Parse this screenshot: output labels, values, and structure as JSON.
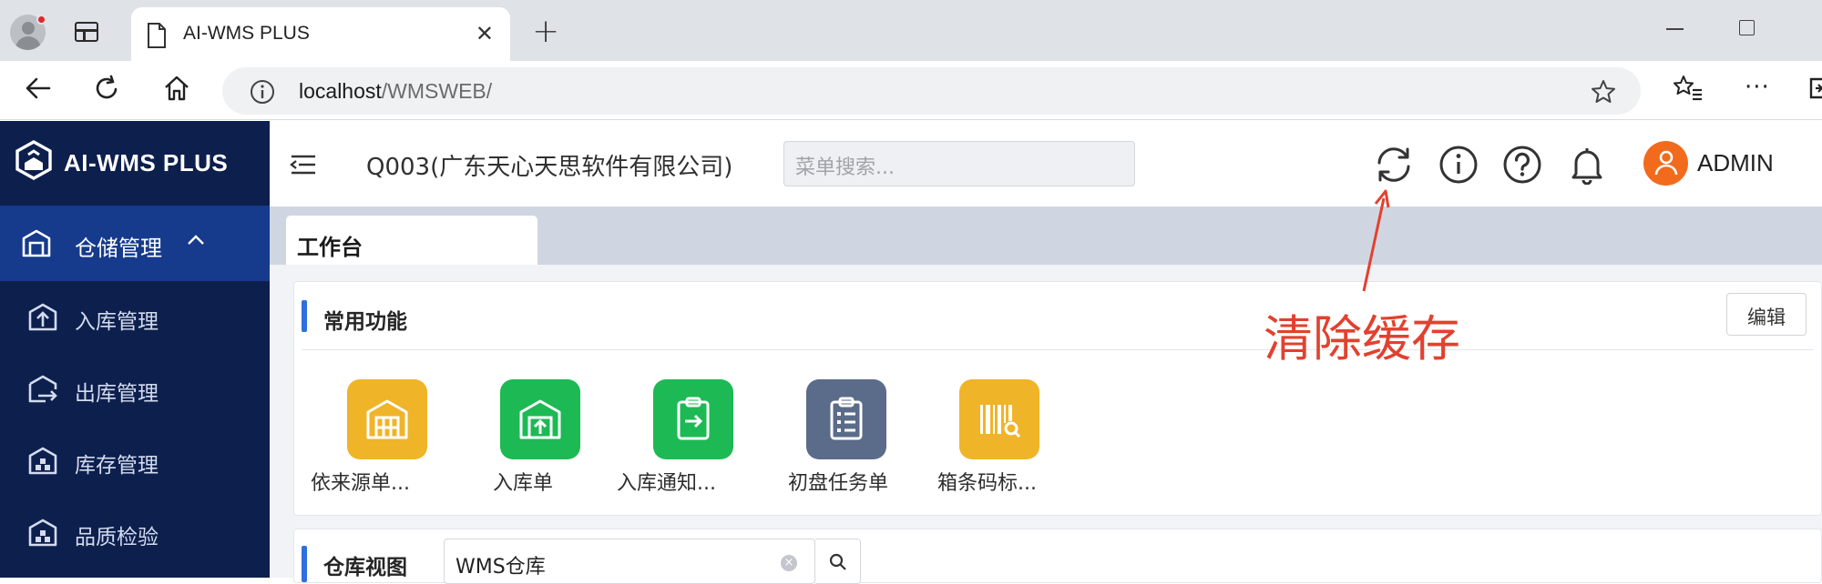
{
  "browser": {
    "tab_title": "AI-WMS PLUS",
    "url_host": "localhost",
    "url_path": "/WMSWEB/"
  },
  "app": {
    "logo_text": "AI-WMS PLUS",
    "company": "Q003(广东天心天思软件有限公司)",
    "search_placeholder": "菜单搜索...",
    "user": "ADMIN"
  },
  "sidebar": {
    "group": "仓储管理",
    "items": [
      {
        "label": "入库管理",
        "icon": "inbound-icon"
      },
      {
        "label": "出库管理",
        "icon": "outbound-icon"
      },
      {
        "label": "库存管理",
        "icon": "inventory-icon"
      },
      {
        "label": "品质检验",
        "icon": "quality-icon"
      }
    ]
  },
  "tabs": {
    "active": "工作台"
  },
  "common_functions": {
    "title": "常用功能",
    "edit_label": "编辑",
    "items": [
      {
        "label": "依来源单...",
        "color": "#f0b429",
        "icon": "warehouse-grid-icon"
      },
      {
        "label": "入库单",
        "color": "#1db954",
        "icon": "warehouse-in-icon"
      },
      {
        "label": "入库通知...",
        "color": "#1db954",
        "icon": "clipboard-arrow-icon"
      },
      {
        "label": "初盘任务单",
        "color": "#5b6b8a",
        "icon": "checklist-icon"
      },
      {
        "label": "箱条码标...",
        "color": "#f0b429",
        "icon": "barcode-search-icon"
      }
    ]
  },
  "warehouse_view": {
    "title": "仓库视图",
    "value": "WMS仓库"
  },
  "annotation": {
    "text": "清除缓存",
    "color": "#e2412f"
  }
}
